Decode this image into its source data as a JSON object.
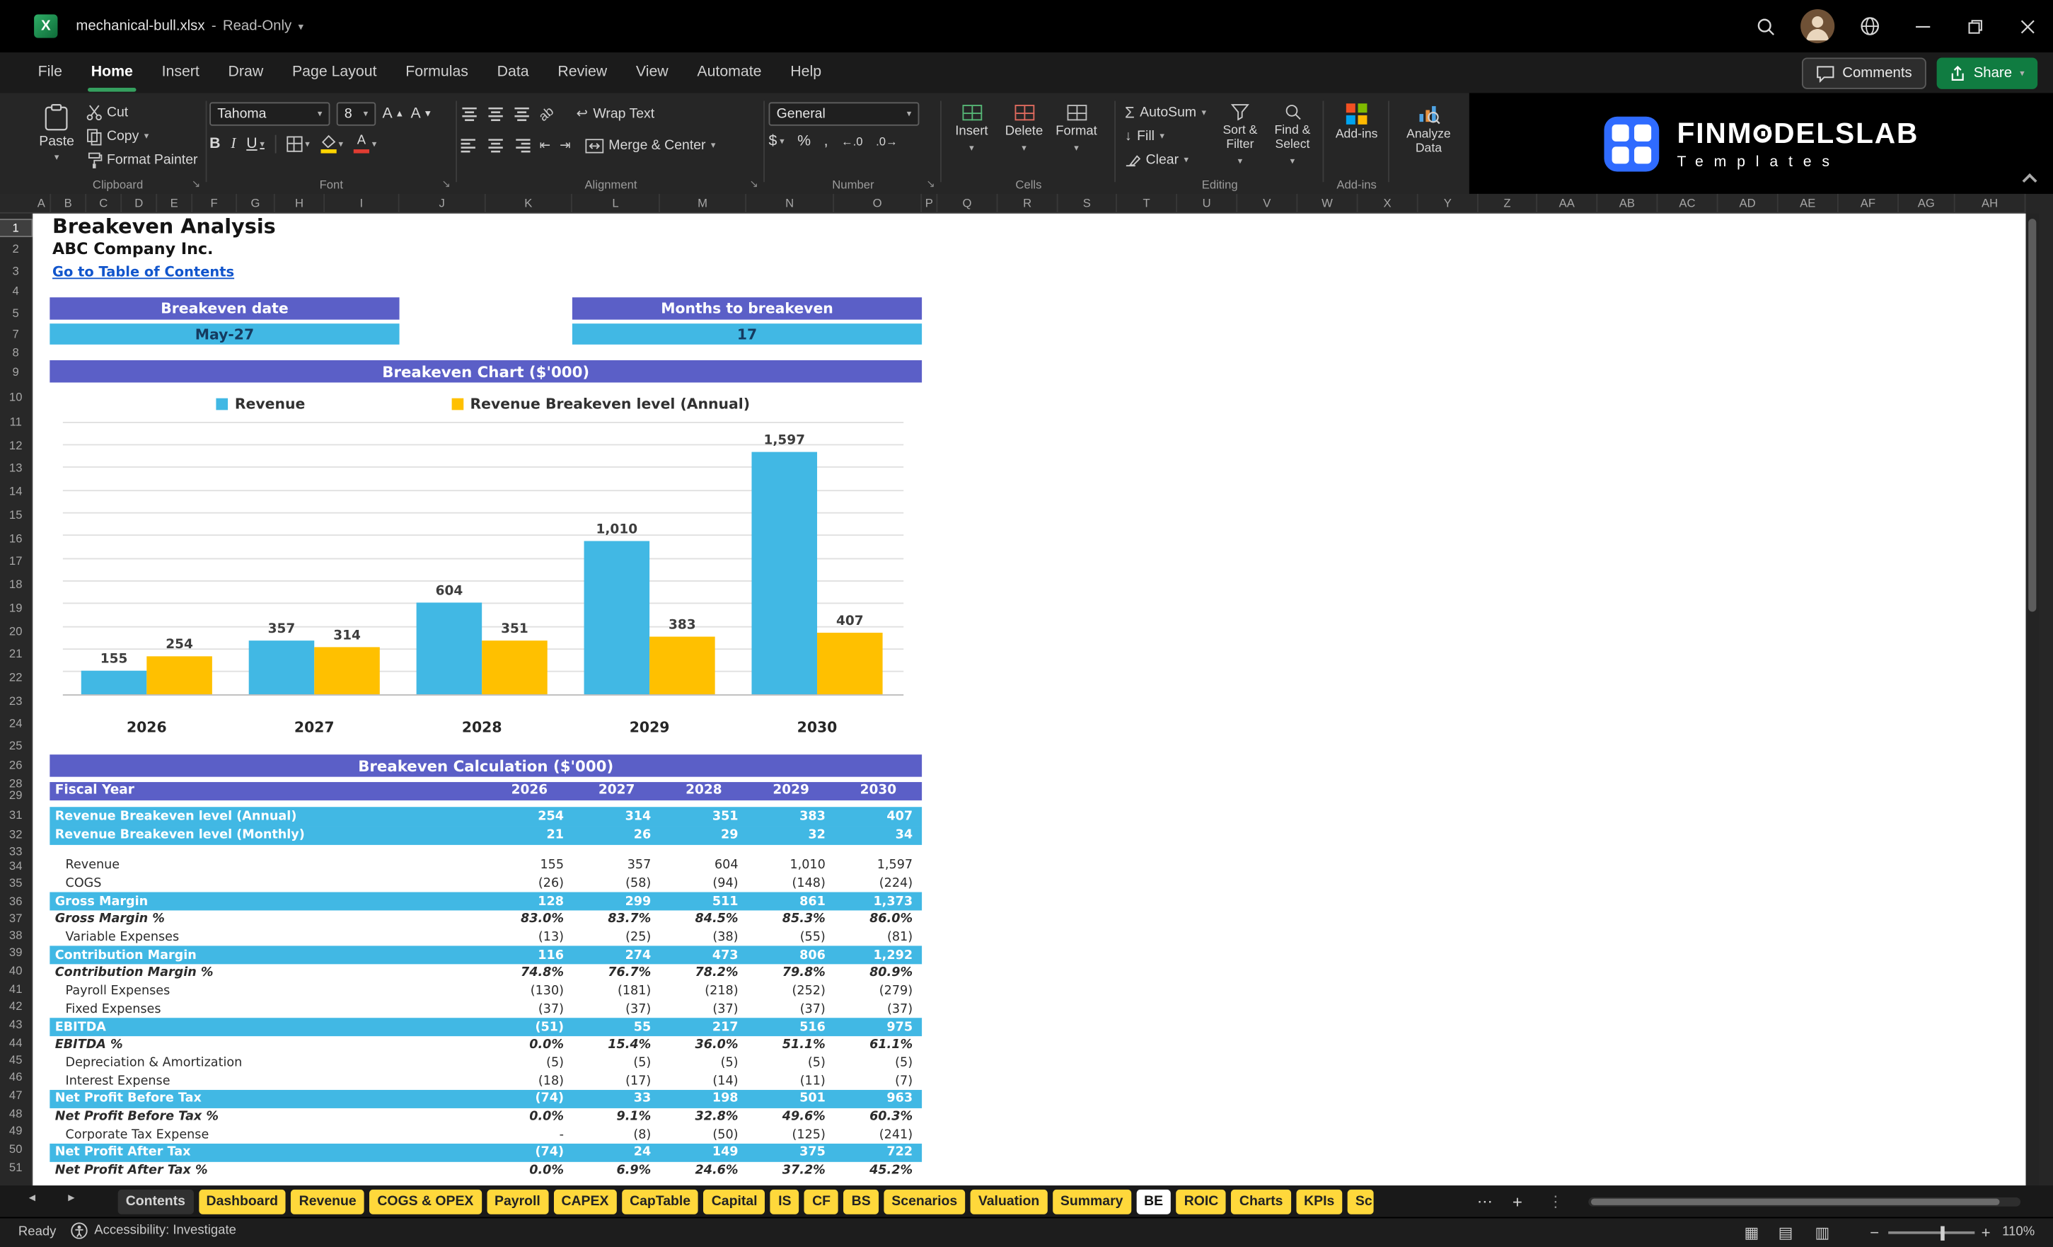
{
  "colors": {
    "header_purple": "#5B5FC7",
    "accent_blue": "#41B8E4",
    "accent_yellow": "#FFC000",
    "tab_yellow": "#FFD83B",
    "excel_green": "#107C41"
  },
  "titlebar": {
    "title": "mechanical-bull.xlsx",
    "separator": "-",
    "mode": "Read-Only"
  },
  "ribbon_tabs": [
    {
      "label": "File",
      "active": false
    },
    {
      "label": "Home",
      "active": true
    },
    {
      "label": "Insert",
      "active": false
    },
    {
      "label": "Draw",
      "active": false
    },
    {
      "label": "Page Layout",
      "active": false
    },
    {
      "label": "Formulas",
      "active": false
    },
    {
      "label": "Data",
      "active": false
    },
    {
      "label": "Review",
      "active": false
    },
    {
      "label": "View",
      "active": false
    },
    {
      "label": "Automate",
      "active": false
    },
    {
      "label": "Help",
      "active": false
    }
  ],
  "top_actions": {
    "comments": "Comments",
    "share": "Share"
  },
  "ribbon": {
    "clipboard": {
      "group": "Clipboard",
      "paste": "Paste",
      "cut": "Cut",
      "copy": "Copy",
      "format_painter": "Format Painter"
    },
    "font": {
      "group": "Font",
      "family": "Tahoma",
      "size": "8"
    },
    "alignment": {
      "group": "Alignment",
      "wrap_text": "Wrap Text",
      "merge_center": "Merge & Center"
    },
    "number": {
      "group": "Number",
      "format": "General"
    },
    "cells": {
      "group": "Cells",
      "insert": "Insert",
      "delete": "Delete",
      "format": "Format"
    },
    "editing": {
      "group": "Editing",
      "autosum": "AutoSum",
      "fill": "Fill",
      "clear": "Clear",
      "sort_filter": "Sort & Filter",
      "find_select": "Find & Select"
    },
    "addins": {
      "group": "Add-ins",
      "label": "Add-ins"
    },
    "analyze": {
      "label": "Analyze Data"
    }
  },
  "brand": {
    "prefix": "FINM",
    "suffix": "DELSLAB",
    "tagline": "Templates"
  },
  "grid": {
    "columns": [
      "A",
      "B",
      "C",
      "D",
      "E",
      "F",
      "G",
      "H",
      "I",
      "J",
      "K",
      "L",
      "M",
      "N",
      "O",
      "P",
      "Q",
      "R",
      "S",
      "T",
      "U",
      "V",
      "W",
      "X",
      "Y",
      "Z",
      "AA",
      "AB",
      "AC",
      "AD",
      "AE",
      "AF",
      "AG",
      "AH"
    ],
    "row_numbers": [
      1,
      2,
      3,
      4,
      5,
      7,
      8,
      9,
      10,
      11,
      12,
      13,
      14,
      15,
      16,
      17,
      18,
      19,
      20,
      21,
      22,
      23,
      24,
      25,
      26,
      28,
      29,
      31,
      32,
      33,
      34,
      35,
      36,
      37,
      38,
      39,
      40,
      41,
      42,
      43,
      44,
      45,
      46,
      47,
      48,
      49,
      50,
      51
    ]
  },
  "sheet": {
    "title": "Breakeven Analysis",
    "company": "ABC Company Inc.",
    "toc_link": "Go to Table of Contents",
    "kpis": [
      {
        "label": "Breakeven date",
        "value": "May-27"
      },
      {
        "label": "Months to breakeven",
        "value": "17"
      }
    ],
    "chart_header": "Breakeven Chart ($'000)",
    "calc_header": "Breakeven Calculation ($'000)"
  },
  "chart_data": {
    "type": "bar",
    "title": "Breakeven Chart ($'000)",
    "categories": [
      "2026",
      "2027",
      "2028",
      "2029",
      "2030"
    ],
    "series": [
      {
        "name": "Revenue",
        "color": "#41B8E4",
        "values": [
          155,
          357,
          604,
          1010,
          1597
        ],
        "labels": [
          "155",
          "357",
          "604",
          "1,010",
          "1,597"
        ]
      },
      {
        "name": "Revenue Breakeven level (Annual)",
        "color": "#FFC000",
        "values": [
          254,
          314,
          351,
          383,
          407
        ],
        "labels": [
          "254",
          "314",
          "351",
          "383",
          "407"
        ]
      }
    ],
    "ylim": [
      0,
      1800
    ],
    "grid": true,
    "legend_position": "top",
    "value_labels": true
  },
  "table": {
    "header_label": "Fiscal Year",
    "years": [
      "2026",
      "2027",
      "2028",
      "2029",
      "2030"
    ],
    "rows": [
      {
        "label": "Revenue Breakeven level (Annual)",
        "style": "highlight",
        "values": [
          "254",
          "314",
          "351",
          "383",
          "407"
        ]
      },
      {
        "label": "Revenue Breakeven level (Monthly)",
        "style": "highlight",
        "values": [
          "21",
          "26",
          "29",
          "32",
          "34"
        ]
      },
      {
        "label": "",
        "style": "spacer",
        "values": [
          "",
          "",
          "",
          "",
          ""
        ]
      },
      {
        "label": "Revenue",
        "style": "detail",
        "values": [
          "155",
          "357",
          "604",
          "1,010",
          "1,597"
        ]
      },
      {
        "label": "COGS",
        "style": "detail",
        "values": [
          "(26)",
          "(58)",
          "(94)",
          "(148)",
          "(224)"
        ]
      },
      {
        "label": "Gross Margin",
        "style": "subtotal",
        "values": [
          "128",
          "299",
          "511",
          "861",
          "1,373"
        ]
      },
      {
        "label": "Gross Margin %",
        "style": "percent",
        "values": [
          "83.0%",
          "83.7%",
          "84.5%",
          "85.3%",
          "86.0%"
        ]
      },
      {
        "label": "Variable Expenses",
        "style": "detail",
        "values": [
          "(13)",
          "(25)",
          "(38)",
          "(55)",
          "(81)"
        ]
      },
      {
        "label": "Contribution Margin",
        "style": "subtotal",
        "values": [
          "116",
          "274",
          "473",
          "806",
          "1,292"
        ]
      },
      {
        "label": "Contribution Margin %",
        "style": "percent",
        "values": [
          "74.8%",
          "76.7%",
          "78.2%",
          "79.8%",
          "80.9%"
        ]
      },
      {
        "label": "Payroll Expenses",
        "style": "detail",
        "values": [
          "(130)",
          "(181)",
          "(218)",
          "(252)",
          "(279)"
        ]
      },
      {
        "label": "Fixed Expenses",
        "style": "detail",
        "values": [
          "(37)",
          "(37)",
          "(37)",
          "(37)",
          "(37)"
        ]
      },
      {
        "label": "EBITDA",
        "style": "subtotal",
        "values": [
          "(51)",
          "55",
          "217",
          "516",
          "975"
        ]
      },
      {
        "label": "EBITDA %",
        "style": "percent",
        "values": [
          "0.0%",
          "15.4%",
          "36.0%",
          "51.1%",
          "61.1%"
        ]
      },
      {
        "label": "Depreciation & Amortization",
        "style": "detail",
        "values": [
          "(5)",
          "(5)",
          "(5)",
          "(5)",
          "(5)"
        ]
      },
      {
        "label": "Interest Expense",
        "style": "detail",
        "values": [
          "(18)",
          "(17)",
          "(14)",
          "(11)",
          "(7)"
        ]
      },
      {
        "label": "Net Profit Before Tax",
        "style": "subtotal",
        "values": [
          "(74)",
          "33",
          "198",
          "501",
          "963"
        ]
      },
      {
        "label": "Net Profit Before Tax %",
        "style": "percent",
        "values": [
          "0.0%",
          "9.1%",
          "32.8%",
          "49.6%",
          "60.3%"
        ]
      },
      {
        "label": "Corporate Tax Expense",
        "style": "detail",
        "values": [
          "-",
          "(8)",
          "(50)",
          "(125)",
          "(241)"
        ]
      },
      {
        "label": "Net Profit After Tax",
        "style": "subtotal",
        "values": [
          "(74)",
          "24",
          "149",
          "375",
          "722"
        ]
      },
      {
        "label": "Net Profit After Tax %",
        "style": "percent",
        "values": [
          "0.0%",
          "6.9%",
          "24.6%",
          "37.2%",
          "45.2%"
        ]
      }
    ]
  },
  "sheet_tabs": [
    {
      "label": "Contents",
      "style": "dark"
    },
    {
      "label": "Dashboard",
      "style": "yellow"
    },
    {
      "label": "Revenue",
      "style": "yellow"
    },
    {
      "label": "COGS & OPEX",
      "style": "yellow"
    },
    {
      "label": "Payroll",
      "style": "yellow"
    },
    {
      "label": "CAPEX",
      "style": "yellow"
    },
    {
      "label": "CapTable",
      "style": "yellow"
    },
    {
      "label": "Capital",
      "style": "yellow"
    },
    {
      "label": "IS",
      "style": "yellow"
    },
    {
      "label": "CF",
      "style": "yellow"
    },
    {
      "label": "BS",
      "style": "yellow"
    },
    {
      "label": "Scenarios",
      "style": "yellow"
    },
    {
      "label": "Valuation",
      "style": "yellow"
    },
    {
      "label": "Summary",
      "style": "yellow"
    },
    {
      "label": "BE",
      "style": "active"
    },
    {
      "label": "ROIC",
      "style": "yellow"
    },
    {
      "label": "Charts",
      "style": "yellow"
    },
    {
      "label": "KPIs",
      "style": "yellow"
    },
    {
      "label": "Sc",
      "style": "yellow",
      "truncated": true
    }
  ],
  "statusbar": {
    "ready": "Ready",
    "accessibility": "Accessibility: Investigate",
    "zoom": "110%"
  }
}
